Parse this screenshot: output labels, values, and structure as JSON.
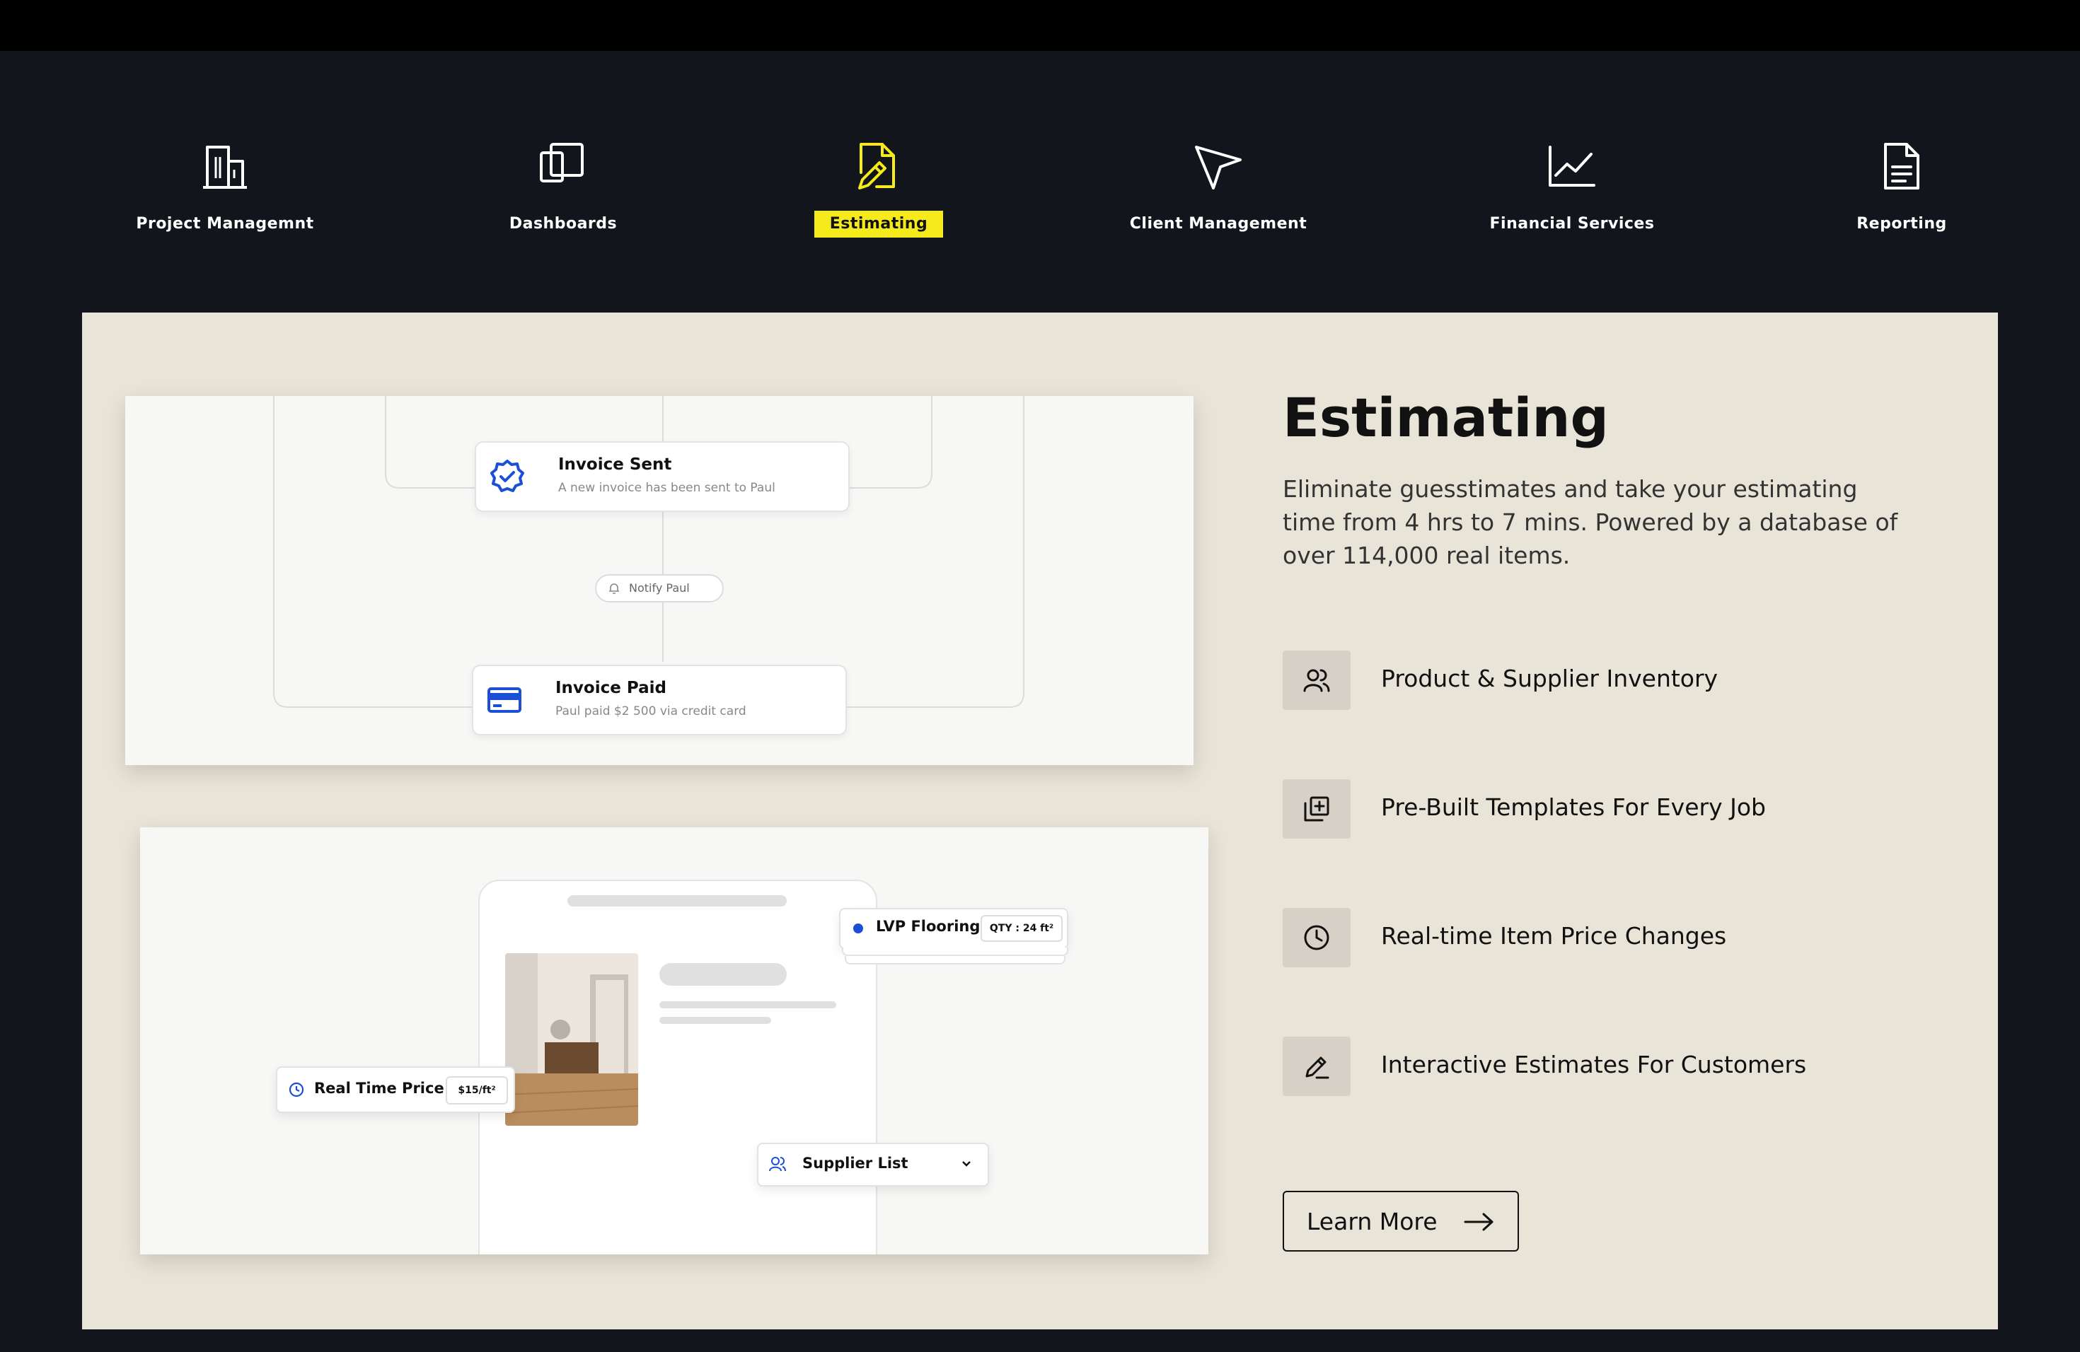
{
  "nav": {
    "items": [
      {
        "label": "Project Managemnt",
        "icon": "building-icon"
      },
      {
        "label": "Dashboards",
        "icon": "dashboard-icon"
      },
      {
        "label": "Estimating",
        "icon": "pencil-ruler-icon",
        "active": true
      },
      {
        "label": "Client Management",
        "icon": "cursor-arrow-icon"
      },
      {
        "label": "Financial Services",
        "icon": "line-chart-icon"
      },
      {
        "label": "Reporting",
        "icon": "document-icon"
      }
    ]
  },
  "workflow": {
    "invoice_sent": {
      "title": "Invoice Sent",
      "subtitle": "A new invoice has been sent to Paul"
    },
    "notify": "Notify Paul",
    "invoice_paid": {
      "title": "Invoice Paid",
      "subtitle": "Paul paid $2 500 via credit card"
    }
  },
  "estimate_mock": {
    "lvp": {
      "label": "LVP Flooring",
      "qty": "QTY : 24 ft²"
    },
    "price": {
      "label": "Real Time Price",
      "value": "$15/ft²"
    },
    "supplier": {
      "label": "Supplier List"
    }
  },
  "content": {
    "heading": "Estimating",
    "description": "Eliminate guesstimates and take your estimating time from 4 hrs to 7 mins. Powered by a database of over 114,000 real items.",
    "features": [
      {
        "label": "Product & Supplier Inventory",
        "icon": "users-icon"
      },
      {
        "label": "Pre-Built Templates For Every Job",
        "icon": "template-add-icon"
      },
      {
        "label": "Real-time Item Price Changes",
        "icon": "clock-icon"
      },
      {
        "label": "Interactive Estimates For Customers",
        "icon": "edit-pencil-icon"
      }
    ],
    "cta": "Learn More"
  },
  "colors": {
    "accent": "#f4ea1c",
    "background": "#12151b",
    "panel": "#e9e4d8",
    "blue": "#1a4fd6"
  }
}
